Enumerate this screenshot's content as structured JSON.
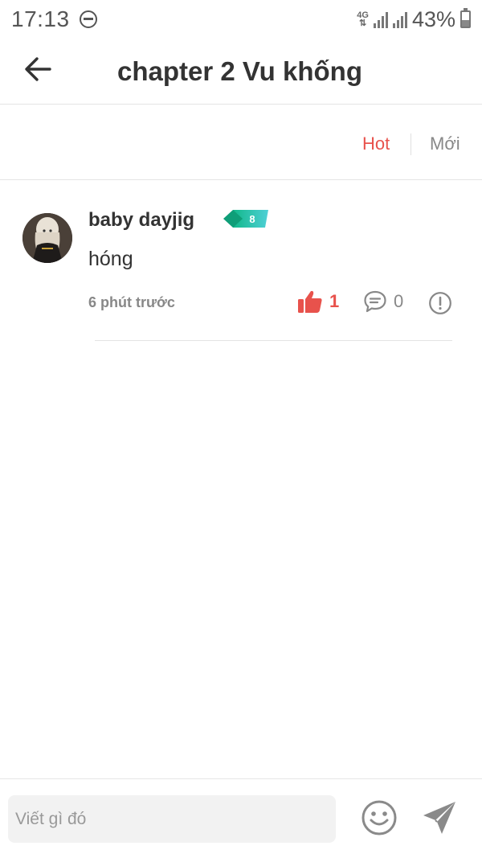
{
  "status_bar": {
    "time": "17:13",
    "network": "4G",
    "battery_pct": "43%",
    "battery_level": 0.43
  },
  "header": {
    "title": "chapter 2 Vu khống"
  },
  "sort": {
    "hot_label": "Hot",
    "new_label": "Mới",
    "active": "hot",
    "active_color": "#e8524c"
  },
  "comments": [
    {
      "username": "baby dayjig",
      "badge_text": "8",
      "body": "hóng",
      "time": "6 phút trước",
      "likes": "1",
      "replies": "0"
    }
  ],
  "composer": {
    "placeholder": "Viết gì đó"
  },
  "icons": [
    "back-arrow-icon",
    "dnd-icon",
    "signal-icon",
    "battery-icon",
    "thumbs-up-icon",
    "comment-icon",
    "report-icon",
    "emoji-icon",
    "send-icon"
  ]
}
